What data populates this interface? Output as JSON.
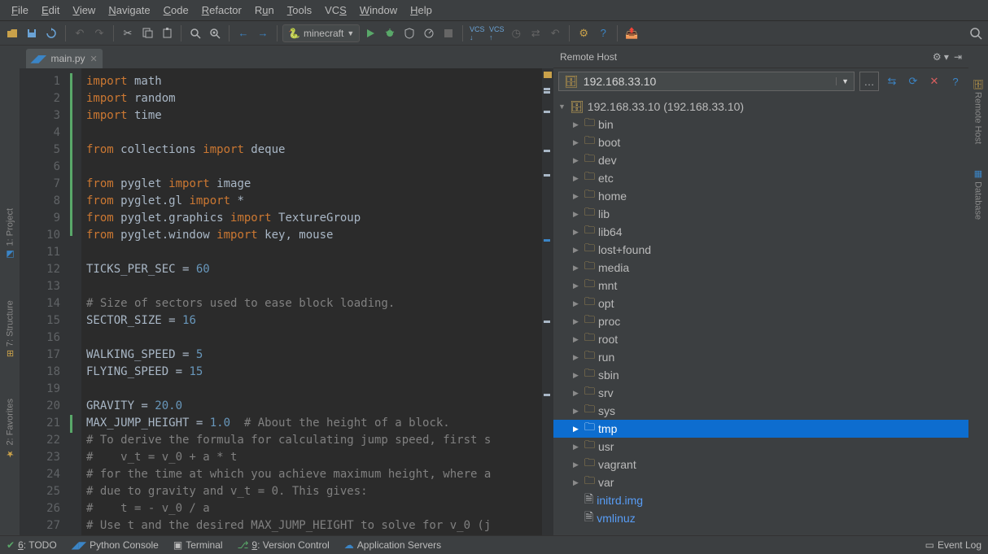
{
  "menubar": [
    {
      "label": "File",
      "ul": "F"
    },
    {
      "label": "Edit",
      "ul": "E"
    },
    {
      "label": "View",
      "ul": "V"
    },
    {
      "label": "Navigate",
      "ul": "N"
    },
    {
      "label": "Code",
      "ul": "C"
    },
    {
      "label": "Refactor",
      "ul": "R"
    },
    {
      "label": "Run",
      "ul": "u"
    },
    {
      "label": "Tools",
      "ul": "T"
    },
    {
      "label": "VCS",
      "ul": "S"
    },
    {
      "label": "Window",
      "ul": "W"
    },
    {
      "label": "Help",
      "ul": "H"
    }
  ],
  "run_config": {
    "label": "minecraft"
  },
  "tabs": [
    {
      "name": "main.py"
    }
  ],
  "code_lines": [
    {
      "n": 1,
      "html": "<span class='kw'>import</span> math"
    },
    {
      "n": 2,
      "html": "<span class='kw'>import</span> random"
    },
    {
      "n": 3,
      "html": "<span class='kw'>import</span> time"
    },
    {
      "n": 4,
      "html": ""
    },
    {
      "n": 5,
      "html": "<span class='kw'>from</span> collections <span class='kw'>import</span> deque"
    },
    {
      "n": 6,
      "html": ""
    },
    {
      "n": 7,
      "html": "<span class='kw'>from</span> pyglet <span class='kw'>import</span> image"
    },
    {
      "n": 8,
      "html": "<span class='kw'>from</span> pyglet.gl <span class='kw'>import</span> *"
    },
    {
      "n": 9,
      "html": "<span class='kw'>from</span> pyglet.graphics <span class='kw'>import</span> TextureGroup"
    },
    {
      "n": 10,
      "html": "<span class='kw'>from</span> pyglet.window <span class='kw'>import</span> key, mouse"
    },
    {
      "n": 11,
      "html": ""
    },
    {
      "n": 12,
      "html": "TICKS_PER_SEC = <span class='num'>60</span>"
    },
    {
      "n": 13,
      "html": ""
    },
    {
      "n": 14,
      "html": "<span class='cmt'># Size of sectors used to ease block loading.</span>"
    },
    {
      "n": 15,
      "html": "SECTOR_SIZE = <span class='num'>16</span>"
    },
    {
      "n": 16,
      "html": ""
    },
    {
      "n": 17,
      "html": "WALKING_SPEED = <span class='num'>5</span>"
    },
    {
      "n": 18,
      "html": "FLYING_SPEED = <span class='num'>15</span>"
    },
    {
      "n": 19,
      "html": ""
    },
    {
      "n": 20,
      "html": "GRAVITY = <span class='num'>20.0</span>"
    },
    {
      "n": 21,
      "html": "MAX_JUMP_HEIGHT = <span class='num'>1.0</span>  <span class='cmt'># About the height of a block.</span>"
    },
    {
      "n": 22,
      "html": "<span class='cmt'># To derive the formula for calculating jump speed, first s</span>"
    },
    {
      "n": 23,
      "html": "<span class='cmt'>#    v_t = v_0 + a * t</span>"
    },
    {
      "n": 24,
      "html": "<span class='cmt'># for the time at which you achieve maximum height, where a</span>"
    },
    {
      "n": 25,
      "html": "<span class='cmt'># due to gravity and v_t = 0. This gives:</span>"
    },
    {
      "n": 26,
      "html": "<span class='cmt'>#    t = - v_0 / a</span>"
    },
    {
      "n": 27,
      "html": "<span class='cmt'># Use t and the desired MAX_JUMP_HEIGHT to solve for v_0 (j</span>"
    }
  ],
  "remote": {
    "title": "Remote Host",
    "host": "192.168.33.10",
    "root_label": "192.168.33.10 (192.168.33.10)",
    "folders": [
      "bin",
      "boot",
      "dev",
      "etc",
      "home",
      "lib",
      "lib64",
      "lost+found",
      "media",
      "mnt",
      "opt",
      "proc",
      "root",
      "run",
      "sbin",
      "srv",
      "sys",
      "tmp",
      "usr",
      "vagrant",
      "var"
    ],
    "selected": "tmp",
    "files": [
      "initrd.img",
      "vmlinuz"
    ]
  },
  "left_panels": [
    {
      "label": "1: Project"
    },
    {
      "label": "7: Structure"
    },
    {
      "label": "2: Favorites"
    }
  ],
  "right_panels": [
    {
      "label": "Remote Host"
    },
    {
      "label": "Database"
    }
  ],
  "status": {
    "todo": "6: TODO",
    "python_console": "Python Console",
    "terminal": "Terminal",
    "vcs": "9: Version Control",
    "appservers": "Application Servers",
    "eventlog": "Event Log"
  }
}
